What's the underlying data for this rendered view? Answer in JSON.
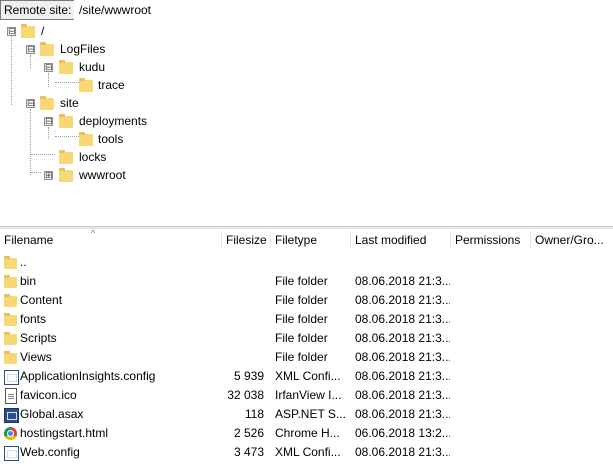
{
  "path_bar": {
    "label": "Remote site:",
    "value": "/site/wwwroot"
  },
  "tree": {
    "nodes": [
      {
        "label": "/",
        "expander": "⊟"
      },
      {
        "label": "LogFiles",
        "expander": "⊟"
      },
      {
        "label": "kudu",
        "expander": "⊟"
      },
      {
        "label": "trace",
        "expander": ""
      },
      {
        "label": "site",
        "expander": "⊟"
      },
      {
        "label": "deployments",
        "expander": "⊟"
      },
      {
        "label": "tools",
        "expander": ""
      },
      {
        "label": "locks",
        "expander": ""
      },
      {
        "label": "wwwroot",
        "expander": "⊞"
      }
    ]
  },
  "list": {
    "columns": [
      "Filename",
      "Filesize",
      "Filetype",
      "Last modified",
      "Permissions",
      "Owner/Gro..."
    ],
    "rows": [
      {
        "name": "..",
        "size": "",
        "type": "",
        "modified": "",
        "icon": "folder"
      },
      {
        "name": "bin",
        "size": "",
        "type": "File folder",
        "modified": "08.06.2018 21:3...",
        "icon": "folder"
      },
      {
        "name": "Content",
        "size": "",
        "type": "File folder",
        "modified": "08.06.2018 21:3...",
        "icon": "folder"
      },
      {
        "name": "fonts",
        "size": "",
        "type": "File folder",
        "modified": "08.06.2018 21:3...",
        "icon": "folder"
      },
      {
        "name": "Scripts",
        "size": "",
        "type": "File folder",
        "modified": "08.06.2018 21:3...",
        "icon": "folder"
      },
      {
        "name": "Views",
        "size": "",
        "type": "File folder",
        "modified": "08.06.2018 21:3...",
        "icon": "folder"
      },
      {
        "name": "ApplicationInsights.config",
        "size": "5 939",
        "type": "XML Confi...",
        "modified": "08.06.2018 21:3...",
        "icon": "config"
      },
      {
        "name": "favicon.ico",
        "size": "32 038",
        "type": "IrfanView I...",
        "modified": "08.06.2018 21:3...",
        "icon": "document"
      },
      {
        "name": "Global.asax",
        "size": "118",
        "type": "ASP.NET S...",
        "modified": "08.06.2018 21:3...",
        "icon": "asp"
      },
      {
        "name": "hostingstart.html",
        "size": "2 526",
        "type": "Chrome H...",
        "modified": "06.06.2018 13:2...",
        "icon": "chrome"
      },
      {
        "name": "Web.config",
        "size": "3 473",
        "type": "XML Confi...",
        "modified": "08.06.2018 21:3...",
        "icon": "config"
      }
    ]
  }
}
